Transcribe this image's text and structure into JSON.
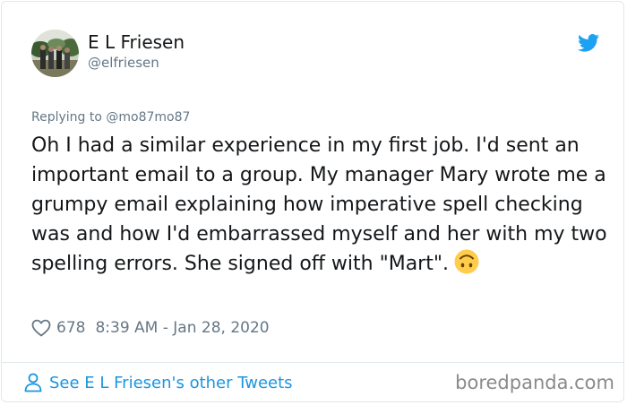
{
  "author": {
    "name": "E L Friesen",
    "handle": "@elfriesen"
  },
  "tweet": {
    "replying_to": "Replying to @mo87mo87",
    "text": "Oh I had a similar experience in my first job. I'd sent an important email to a group. My manager Mary wrote me a grumpy email explaining how imperative spell checking was and how I'd embarrassed myself and her with my two spelling errors. She signed off with \"Mart\".",
    "emoji": "upside-down-face-icon",
    "likes": "678",
    "timestamp": "8:39 AM - Jan 28, 2020"
  },
  "footer": {
    "more_tweets_label": "See E L Friesen's other Tweets"
  },
  "watermark": "boredpanda.com",
  "colors": {
    "text": "#14171a",
    "secondary": "#657786",
    "link": "#1b95e0",
    "twitter_blue": "#1da1f2",
    "emoji": "#ffcc4d",
    "border": "#e1e8ed",
    "watermark": "#8a8a8a"
  }
}
